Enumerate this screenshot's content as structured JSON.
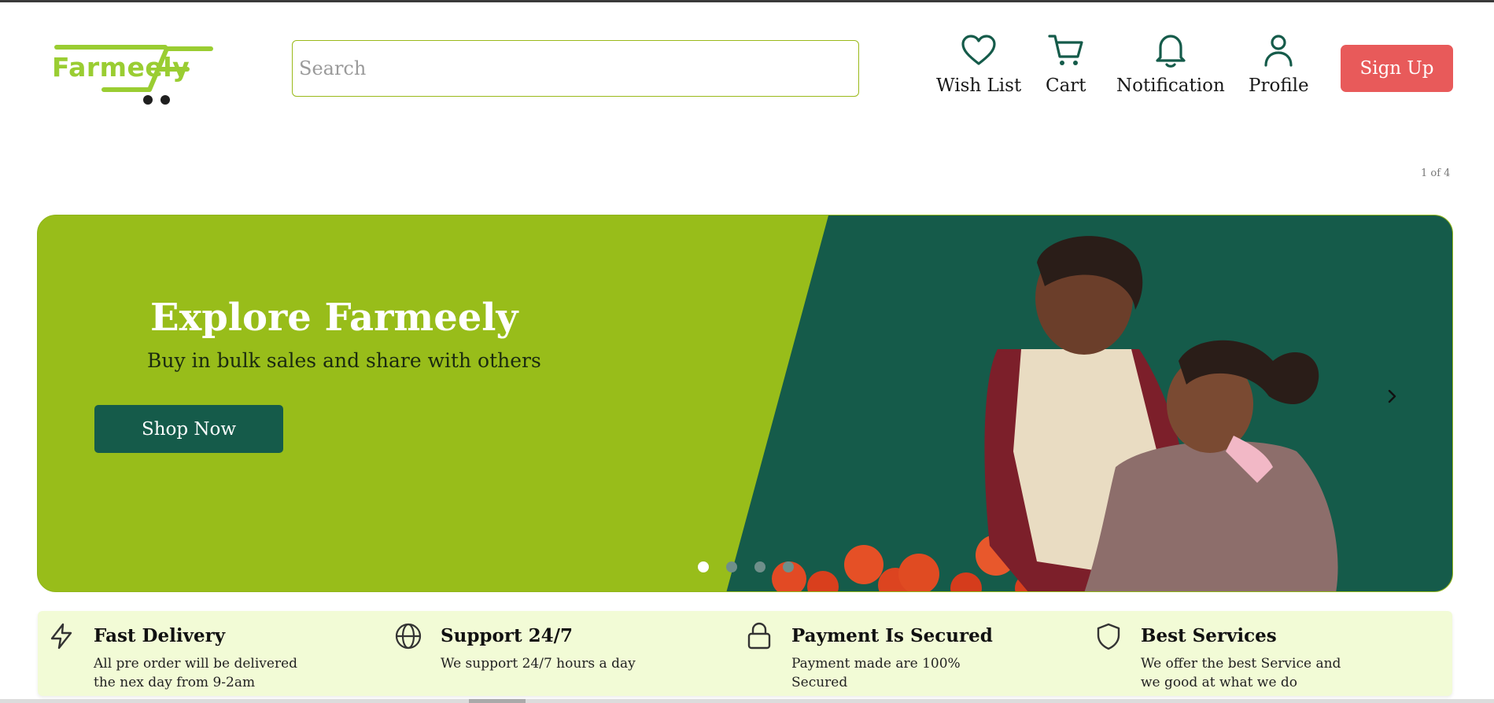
{
  "header": {
    "logo_text": "Farmeely",
    "search_placeholder": "Search",
    "nav": [
      {
        "label": "Wish List",
        "icon": "heart-icon"
      },
      {
        "label": "Cart",
        "icon": "cart-icon"
      },
      {
        "label": "Notification",
        "icon": "bell-icon"
      },
      {
        "label": "Profile",
        "icon": "user-icon"
      }
    ],
    "signup_label": "Sign Up"
  },
  "carousel": {
    "counter": "1 of 4",
    "title": "Explore Farmeely",
    "subtitle": "Buy in bulk sales and share with others",
    "cta_label": "Shop Now",
    "slides_total": 4,
    "active_slide": 1
  },
  "features": [
    {
      "icon": "lightning-icon",
      "title": "Fast Delivery",
      "desc": "All pre order will be delivered the nex day from 9-2am"
    },
    {
      "icon": "globe-icon",
      "title": "Support 24/7",
      "desc": "We support 24/7 hours a day"
    },
    {
      "icon": "lock-icon",
      "title": "Payment Is Secured",
      "desc": "Payment made are 100% Secured"
    },
    {
      "icon": "shield-icon",
      "title": "Best Services",
      "desc": "We offer the best Service and we good at what we do"
    }
  ],
  "colors": {
    "brand_green": "#9acd32",
    "hero_green": "#98bd1a",
    "dark_teal": "#155b4a",
    "signup_red": "#e85a5a",
    "features_bg": "#f2fbd6"
  }
}
